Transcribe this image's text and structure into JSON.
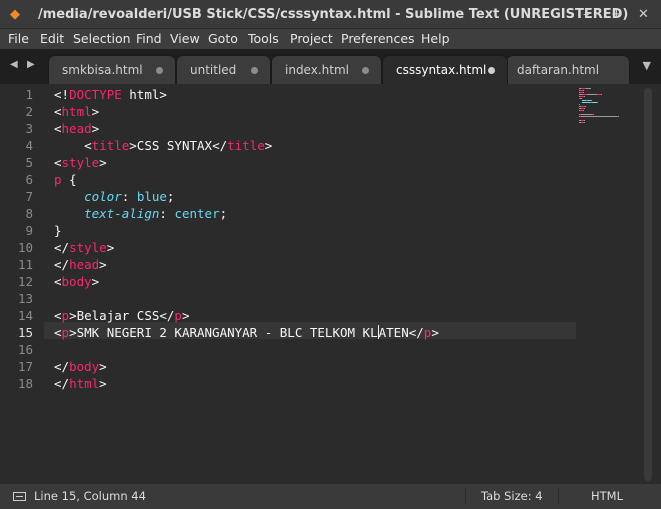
{
  "window": {
    "title": "/media/revoalderi/USB Stick/CSS/csssyntax.html - Sublime Text (UNREGISTERED)",
    "app_icon": "sublime-text-icon",
    "controls": {
      "minimize": "–",
      "maximize": "+",
      "close": "✕"
    }
  },
  "menu": {
    "items": [
      "File",
      "Edit",
      "Selection",
      "Find",
      "View",
      "Goto",
      "Tools",
      "Project",
      "Preferences",
      "Help"
    ]
  },
  "tabs": [
    {
      "label": "smkbisa.html",
      "active": false
    },
    {
      "label": "untitled",
      "active": false
    },
    {
      "label": "index.html",
      "active": false
    },
    {
      "label": "csssyntax.html",
      "active": true
    },
    {
      "label": "daftaran.html",
      "active": false
    }
  ],
  "tab_nav": {
    "prev": "◀",
    "next": "▶",
    "overflow": "▼"
  },
  "editor": {
    "current_line": 15,
    "line_numbers": [
      "1",
      "2",
      "3",
      "4",
      "5",
      "6",
      "7",
      "8",
      "9",
      "10",
      "11",
      "12",
      "13",
      "14",
      "15",
      "16",
      "17",
      "18"
    ],
    "lines": [
      [
        {
          "t": "<!",
          "c": "p"
        },
        {
          "t": "DOCTYPE",
          "c": "tag"
        },
        {
          "t": " html>",
          "c": "p"
        }
      ],
      [
        {
          "t": "<",
          "c": "p"
        },
        {
          "t": "html",
          "c": "tag"
        },
        {
          "t": ">",
          "c": "p"
        }
      ],
      [
        {
          "t": "<",
          "c": "p"
        },
        {
          "t": "head",
          "c": "tag"
        },
        {
          "t": ">",
          "c": "p"
        }
      ],
      [
        {
          "t": "    <",
          "c": "p"
        },
        {
          "t": "title",
          "c": "tag"
        },
        {
          "t": ">CSS SYNTAX</",
          "c": "p"
        },
        {
          "t": "title",
          "c": "tag"
        },
        {
          "t": ">",
          "c": "p"
        }
      ],
      [
        {
          "t": "<",
          "c": "p"
        },
        {
          "t": "style",
          "c": "tag"
        },
        {
          "t": ">",
          "c": "p"
        }
      ],
      [
        {
          "t": "p",
          "c": "tag"
        },
        {
          "t": " {",
          "c": "p"
        }
      ],
      [
        {
          "t": "    ",
          "c": "p"
        },
        {
          "t": "color",
          "c": "prop"
        },
        {
          "t": ": ",
          "c": "p"
        },
        {
          "t": "blue",
          "c": "val"
        },
        {
          "t": ";",
          "c": "p"
        }
      ],
      [
        {
          "t": "    ",
          "c": "p"
        },
        {
          "t": "text-align",
          "c": "prop"
        },
        {
          "t": ": ",
          "c": "p"
        },
        {
          "t": "center",
          "c": "val"
        },
        {
          "t": ";",
          "c": "p"
        }
      ],
      [
        {
          "t": "}",
          "c": "p"
        }
      ],
      [
        {
          "t": "</",
          "c": "p"
        },
        {
          "t": "style",
          "c": "tag"
        },
        {
          "t": ">",
          "c": "p"
        }
      ],
      [
        {
          "t": "</",
          "c": "p"
        },
        {
          "t": "head",
          "c": "tag"
        },
        {
          "t": ">",
          "c": "p"
        }
      ],
      [
        {
          "t": "<",
          "c": "p"
        },
        {
          "t": "body",
          "c": "tag"
        },
        {
          "t": ">",
          "c": "p"
        }
      ],
      [],
      [
        {
          "t": "<",
          "c": "p"
        },
        {
          "t": "p",
          "c": "tag"
        },
        {
          "t": ">Belajar CSS</",
          "c": "p"
        },
        {
          "t": "p",
          "c": "tag"
        },
        {
          "t": ">",
          "c": "p"
        }
      ],
      [
        {
          "t": "<",
          "c": "p"
        },
        {
          "t": "p",
          "c": "tag"
        },
        {
          "t": ">SMK NEGERI 2 KARANGANYAR - BLC TELKOM KL",
          "c": "p"
        },
        {
          "t": "|",
          "c": "cursor"
        },
        {
          "t": "ATEN</",
          "c": "p"
        },
        {
          "t": "p",
          "c": "tag"
        },
        {
          "t": ">",
          "c": "p"
        }
      ],
      [],
      [
        {
          "t": "</",
          "c": "p"
        },
        {
          "t": "body",
          "c": "tag"
        },
        {
          "t": ">",
          "c": "p"
        }
      ],
      [
        {
          "t": "</",
          "c": "p"
        },
        {
          "t": "html",
          "c": "tag"
        },
        {
          "t": ">",
          "c": "p"
        }
      ]
    ]
  },
  "colors": {
    "tag": "#f92672",
    "property": "#66d9ef",
    "value": "#66d9ef",
    "plain": "#f8f8f2",
    "background": "#2b2b2b"
  },
  "status": {
    "panel_icon": "panel-toggle-icon",
    "position": "Line 15, Column 44",
    "tab_size": "Tab Size: 4",
    "syntax": "HTML"
  }
}
